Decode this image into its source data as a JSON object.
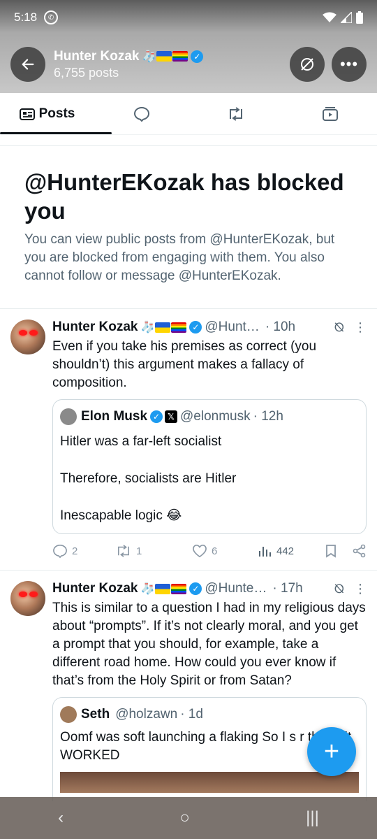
{
  "status": {
    "time": "5:18"
  },
  "profile": {
    "name": "Hunter Kozak",
    "posts": "6,755 posts",
    "emoji_socks": "🧦"
  },
  "tabs": [
    {
      "label": "Posts",
      "icon": "feed-icon"
    },
    {
      "label": "",
      "icon": "reply-icon"
    },
    {
      "label": "",
      "icon": "repost-icon"
    },
    {
      "label": "",
      "icon": "media-icon"
    }
  ],
  "blocked": {
    "title": "@HunterEKozak has blocked you",
    "body": "You can view public posts from @HunterEKozak, but you are blocked from engaging with them. You also cannot follow or message @HunterEKozak."
  },
  "posts": [
    {
      "name": "Hunter Kozak",
      "handle": "@Hunt…",
      "time": "· 10h",
      "text": "Even if you take his premises as correct (you shouldn’t) this argument makes a fallacy of composition.",
      "quote": {
        "name": "Elon Musk",
        "handle": "@elonmusk",
        "time": "· 12h",
        "line1": "Hitler was a far-left socialist",
        "line2": "Therefore, socialists are Hitler",
        "line3": "Inescapable logic 😂"
      },
      "actions": {
        "replies": "2",
        "reposts": "1",
        "likes": "6",
        "views": "442"
      }
    },
    {
      "name": "Hunter Kozak",
      "handle": "@Hunte…",
      "time": "· 17h",
      "text": "This is similar to a question I had in my religious days about “prompts”. If it’s not clearly moral, and you get a prompt that you should, for example, take a different road home. How could you ever know if that’s from the Holy Spirit or from Satan?",
      "quote": {
        "name": "Seth",
        "handle": "@holzawn",
        "time": "· 1d",
        "text": "Oomf was soft launching a flaking So I s        r this & it WORKED"
      }
    }
  ],
  "fab": {
    "label": "+"
  },
  "nav": {
    "back": "‹",
    "home": "○",
    "recents": "|||"
  }
}
